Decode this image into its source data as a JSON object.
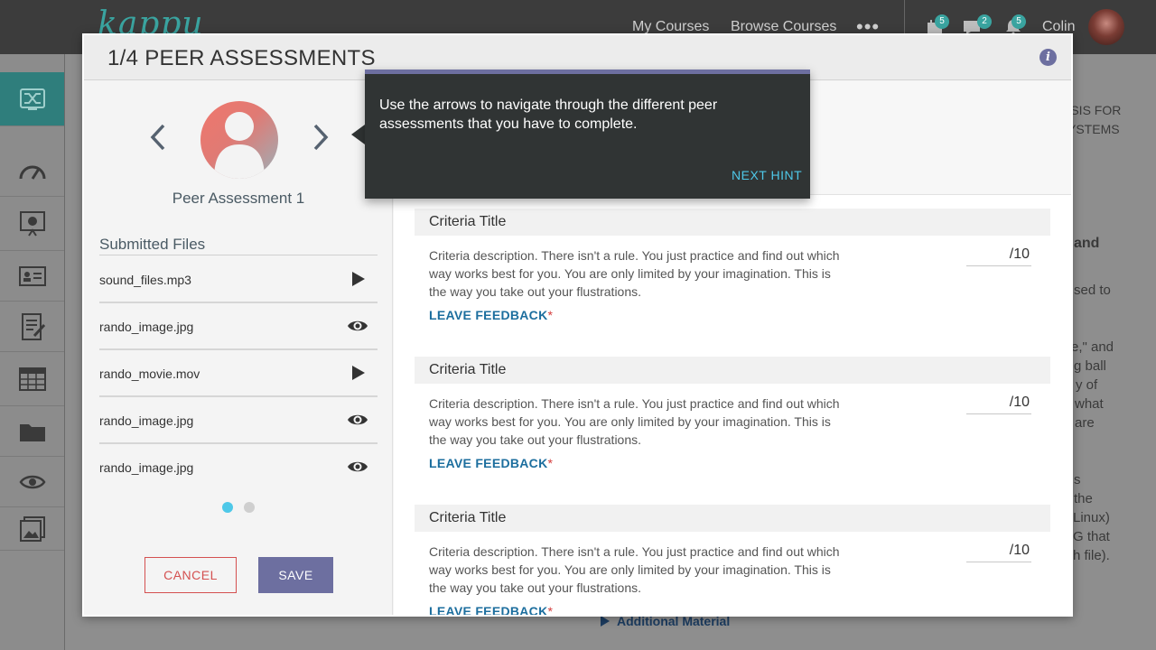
{
  "app": {
    "logo": "kappu",
    "nav": {
      "my_courses": "My Courses",
      "browse_courses": "Browse Courses",
      "more": "•••",
      "badges": [
        "5",
        "2",
        "5"
      ],
      "user": "Colin"
    },
    "sidebar": [
      "shuffle-icon",
      "dashboard-icon",
      "presentation-icon",
      "id-card-icon",
      "document-edit-icon",
      "table-icon",
      "folder-icon",
      "eye-cycle-icon",
      "gallery-icon"
    ],
    "background": {
      "text_fragments": [
        "ESIS FOR",
        "YSTEMS",
        "and",
        "sed to",
        "e,\" and",
        "g ball",
        "y of",
        "what",
        "are",
        "s",
        "the",
        "Linux)",
        "G that",
        "h file)."
      ],
      "additional_material": "Additional Material"
    }
  },
  "modal": {
    "title": "1/4 PEER ASSESSMENTS",
    "info_icon": "i",
    "peer_name": "Peer Assessment 1",
    "files_title": "Submitted Files",
    "files": [
      {
        "name": "sound_files.mp3",
        "action": "play-icon"
      },
      {
        "name": "rando_image.jpg",
        "action": "eye-icon"
      },
      {
        "name": "rando_movie.mov",
        "action": "play-icon"
      },
      {
        "name": "rando_image.jpg",
        "action": "eye-icon"
      },
      {
        "name": "rando_image.jpg",
        "action": "eye-icon"
      }
    ],
    "pagination": {
      "active": 1,
      "total": 2
    },
    "cancel": "CANCEL",
    "save": "SAVE",
    "criteria": [
      {
        "title": "Criteria Title",
        "description": "Criteria description. There isn't a rule. You just practice and find out which way works best for you. You are only limited by your imagination. This is the way you take out your flustrations.",
        "score": "/10",
        "feedback": "LEAVE FEEDBACK",
        "required": "*"
      },
      {
        "title": "Criteria Title",
        "description": "Criteria description. There isn't a rule. You just practice and find out which way works best for you. You are only limited by your imagination. This is the way you take out your flustrations.",
        "score": "/10",
        "feedback": "LEAVE FEEDBACK",
        "required": "*"
      },
      {
        "title": "Criteria Title",
        "description": "Criteria description. There isn't a rule. You just practice and find out which way works best for you. You are only limited by your imagination. This is the way you take out your flustrations.",
        "score": "/10",
        "feedback": "LEAVE FEEDBACK",
        "required": "*"
      }
    ]
  },
  "hint": {
    "text": "Use the arrows to navigate through the different peer assessments that you have to complete.",
    "next": "NEXT HINT"
  },
  "colors": {
    "accent": "#6d6fa0",
    "teal": "#3aa4a0",
    "link": "#1c6e9e",
    "danger": "#d45050",
    "hint_bg": "#303434",
    "hint_link": "#4ec8e8"
  }
}
